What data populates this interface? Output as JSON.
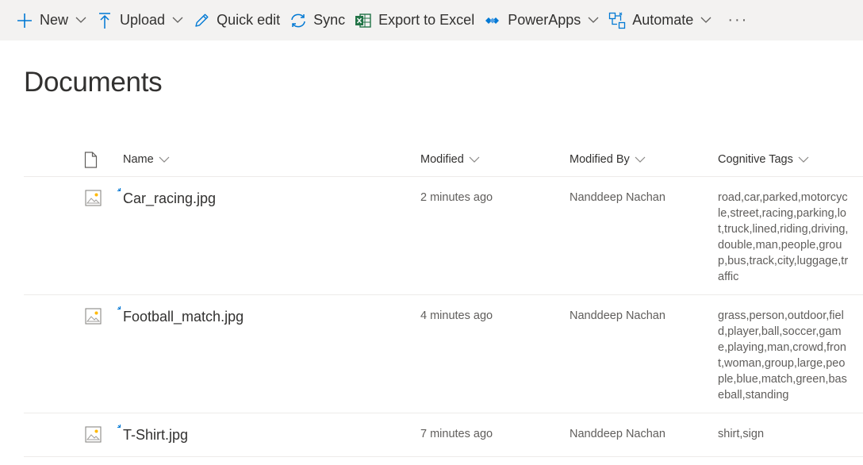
{
  "toolbar": {
    "new_label": "New",
    "upload_label": "Upload",
    "quick_edit_label": "Quick edit",
    "sync_label": "Sync",
    "export_label": "Export to Excel",
    "powerapps_label": "PowerApps",
    "automate_label": "Automate",
    "more_label": "···"
  },
  "page": {
    "title": "Documents"
  },
  "columns": {
    "name": "Name",
    "modified": "Modified",
    "modified_by": "Modified By",
    "tags": "Cognitive Tags"
  },
  "rows": [
    {
      "name": "Car_racing.jpg",
      "modified": "2 minutes ago",
      "modified_by": "Nanddeep Nachan",
      "tags": "road,car,parked,motorcycle,street,racing,parking,lot,truck,lined,riding,driving,double,man,people,group,bus,track,city,luggage,traffic"
    },
    {
      "name": "Football_match.jpg",
      "modified": "4 minutes ago",
      "modified_by": "Nanddeep Nachan",
      "tags": "grass,person,outdoor,field,player,ball,soccer,game,playing,man,crowd,front,woman,group,large,people,blue,match,green,baseball,standing"
    },
    {
      "name": "T-Shirt.jpg",
      "modified": "7 minutes ago",
      "modified_by": "Nanddeep Nachan",
      "tags": "shirt,sign"
    }
  ],
  "colors": {
    "accent": "#0078d4",
    "command_bar_bg": "#f3f2f1",
    "excel_green": "#217346",
    "text_primary": "#323130",
    "text_secondary": "#605e5c",
    "divider": "#edebe9"
  },
  "icons": {
    "new": "plus-icon",
    "upload": "upload-arrow-icon",
    "quick_edit": "pencil-icon",
    "sync": "sync-icon",
    "export": "excel-icon",
    "powerapps": "powerapps-icon",
    "automate": "flow-icon",
    "file_type": "document-icon",
    "image_file": "image-file-icon",
    "new_item": "new-item-sparkle-icon"
  }
}
